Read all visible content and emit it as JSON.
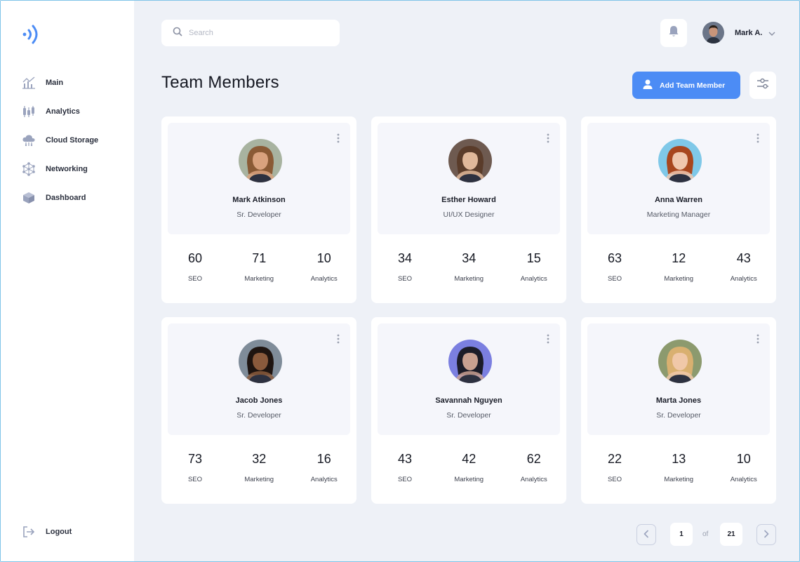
{
  "nav": [
    {
      "label": "Main",
      "icon": "chart-line-icon"
    },
    {
      "label": "Analytics",
      "icon": "candlestick-icon"
    },
    {
      "label": "Cloud Storage",
      "icon": "cloud-icon"
    },
    {
      "label": "Networking",
      "icon": "network-icon"
    },
    {
      "label": "Dashboard",
      "icon": "cube-icon"
    }
  ],
  "logout_label": "Logout",
  "search": {
    "placeholder": "Search"
  },
  "user": {
    "name": "Mark A."
  },
  "page_title": "Team Members",
  "add_button_label": "Add Team Member",
  "stat_labels": [
    "SEO",
    "Marketing",
    "Analytics"
  ],
  "members": [
    {
      "name": "Mark Atkinson",
      "role": "Sr. Developer",
      "stats": [
        "60",
        "71",
        "10"
      ],
      "skin": "#d9a27e",
      "hair": "#8a5a35",
      "bg": "#a8b3a0"
    },
    {
      "name": "Esther Howard",
      "role": "UI/UX Designer",
      "stats": [
        "34",
        "34",
        "15"
      ],
      "skin": "#e0b89a",
      "hair": "#5a3c2a",
      "bg": "#6e5a50"
    },
    {
      "name": "Anna Warren",
      "role": "Marketing Manager",
      "stats": [
        "63",
        "12",
        "43"
      ],
      "skin": "#f0c7ae",
      "hair": "#a8461e",
      "bg": "#7fc8e8"
    },
    {
      "name": "Jacob Jones",
      "role": "Sr. Developer",
      "stats": [
        "73",
        "32",
        "16"
      ],
      "skin": "#8a5a3c",
      "hair": "#1e1410",
      "bg": "#7f8c99"
    },
    {
      "name": "Savannah Nguyen",
      "role": "Sr. Developer",
      "stats": [
        "43",
        "42",
        "62"
      ],
      "skin": "#c9a090",
      "hair": "#1c1c28",
      "bg": "#7b7fe0"
    },
    {
      "name": "Marta Jones",
      "role": "Sr. Developer",
      "stats": [
        "22",
        "13",
        "10"
      ],
      "skin": "#f0c8a8",
      "hair": "#d9b070",
      "bg": "#8c9a6e"
    }
  ],
  "pagination": {
    "current": "1",
    "of_label": "of",
    "total": "21"
  },
  "colors": {
    "accent": "#4c8cf5",
    "background": "#eef1f7",
    "sidebar_icon": "#9aa3bd"
  }
}
